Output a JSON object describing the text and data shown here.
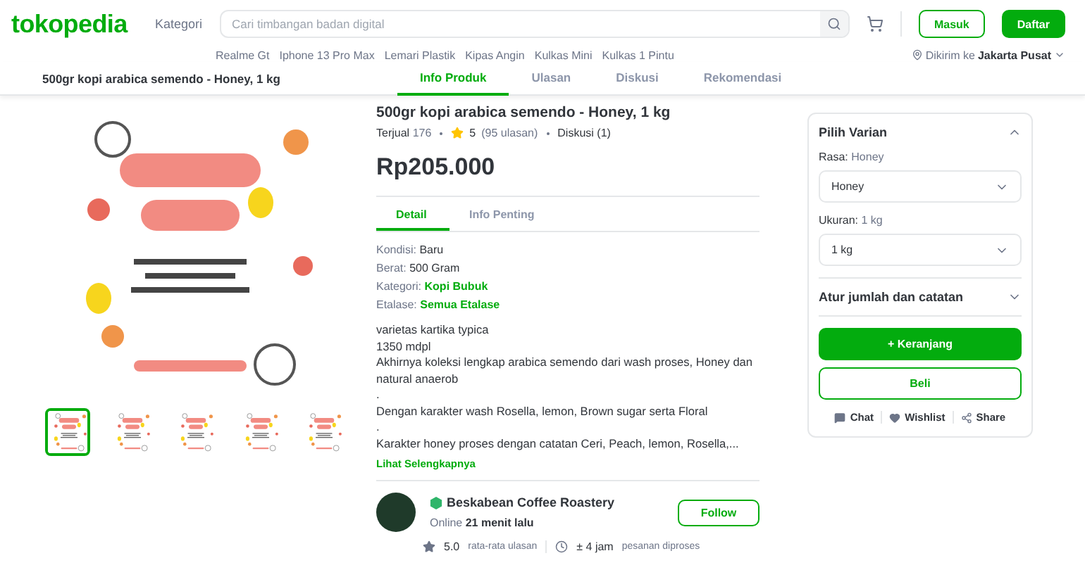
{
  "header": {
    "logo": "tokopedia",
    "category_link": "Kategori",
    "search_placeholder": "Cari timbangan badan digital",
    "login_button": "Masuk",
    "register_button": "Daftar"
  },
  "keywords": [
    "Realme Gt",
    "Iphone 13 Pro Max",
    "Lemari Plastik",
    "Kipas Angin",
    "Kulkas Mini",
    "Kulkas 1 Pintu"
  ],
  "location": {
    "label": "Dikirim ke",
    "value": "Jakarta Pusat"
  },
  "sticky_bar": {
    "title": "500gr kopi arabica semendo - Honey, 1 kg",
    "tabs": [
      {
        "label": "Info Produk",
        "selected": true
      },
      {
        "label": "Ulasan",
        "selected": false
      },
      {
        "label": "Diskusi",
        "selected": false
      },
      {
        "label": "Rekomendasi",
        "selected": false
      }
    ]
  },
  "gallery": {
    "thumbnails": [
      {
        "selected": true
      },
      {
        "selected": false
      },
      {
        "selected": false
      },
      {
        "selected": false
      },
      {
        "selected": false
      }
    ]
  },
  "product": {
    "title": "500gr kopi arabica semendo - Honey, 1 kg",
    "sold_label": "Terjual",
    "sold": "176",
    "rating": "5",
    "reviews": "(95 ulasan)",
    "discussion": "Diskusi (1)",
    "price": "Rp205.000"
  },
  "detail_tabs": [
    {
      "label": "Detail",
      "selected": true
    },
    {
      "label": "Info Penting",
      "selected": false
    }
  ],
  "specs": [
    {
      "label": "Kondisi:",
      "value": "Baru",
      "link": false
    },
    {
      "label": "Berat:",
      "value": "500 Gram",
      "link": false
    },
    {
      "label": "Kategori:",
      "value": "Kopi Bubuk",
      "link": true
    },
    {
      "label": "Etalase:",
      "value": "Semua Etalase",
      "link": true
    }
  ],
  "description": [
    "varietas kartika typica",
    "1350 mdpl",
    "Akhirnya koleksi lengkap arabica semendo dari wash proses, Honey dan natural anaerob",
    ".",
    "Dengan karakter wash Rosella, lemon, Brown sugar serta Floral",
    ".",
    "Karakter honey proses dengan catatan Ceri, Peach, lemon, Rosella,..."
  ],
  "more_link": "Lihat Selengkapnya",
  "shop": {
    "name": "Beskabean Coffee Roastery",
    "status": "Online",
    "last_seen": "21 menit lalu",
    "follow_button": "Follow",
    "rating": "5.0",
    "rating_label": "rata-rata ulasan",
    "process_time": "± 4 jam",
    "process_label": "pesanan diproses"
  },
  "variant_card": {
    "title": "Pilih Varian",
    "expanded": true,
    "options": [
      {
        "label": "Rasa:",
        "value": "Honey",
        "choice": "Honey"
      },
      {
        "label": "Ukuran:",
        "value": "1 kg",
        "choice": "1 kg"
      }
    ],
    "notes_title": "Atur jumlah dan catatan",
    "notes_expanded": false,
    "cart_button": "+ Keranjang",
    "buy_button": "Beli",
    "actions": [
      {
        "kind": "chat",
        "label": "Chat"
      },
      {
        "kind": "wishlist",
        "label": "Wishlist"
      },
      {
        "kind": "share",
        "label": "Share"
      }
    ]
  }
}
